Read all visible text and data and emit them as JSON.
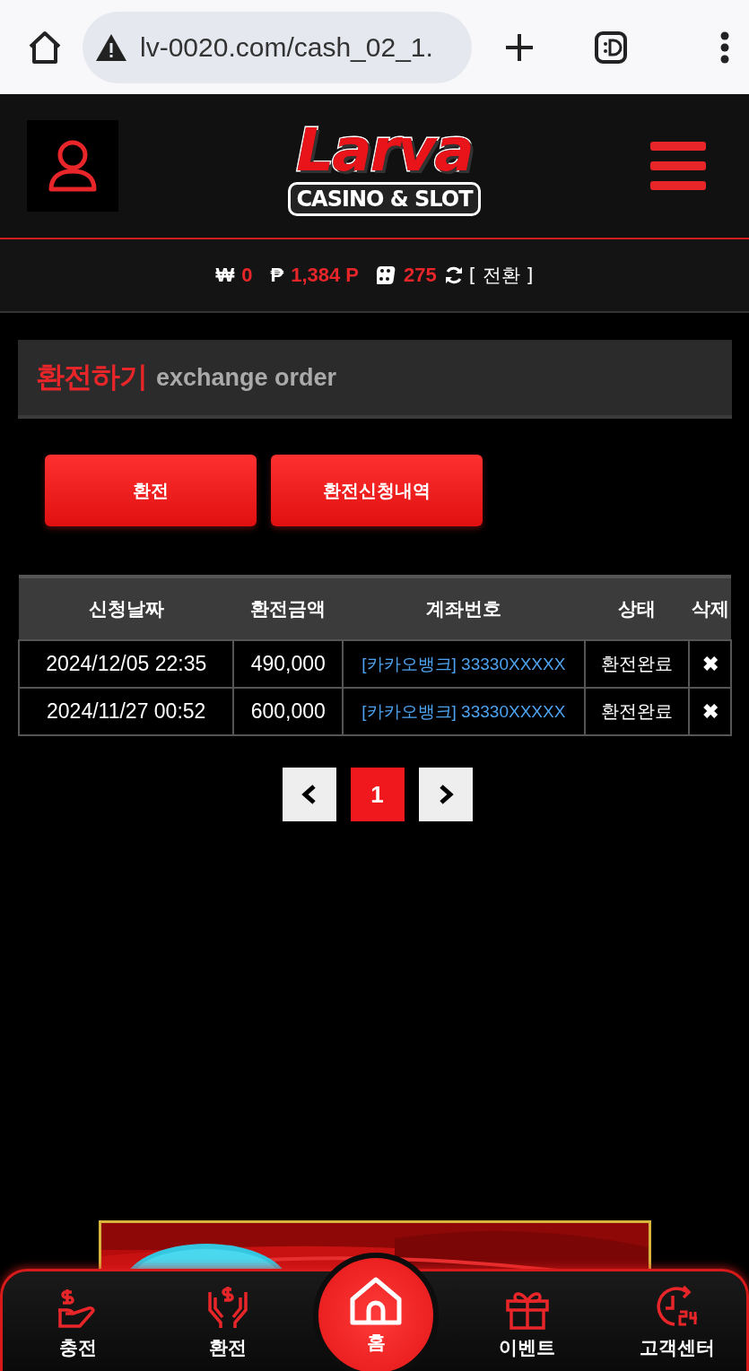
{
  "browser": {
    "url": "lv-0020.com/cash_02_1."
  },
  "header": {
    "logo": {
      "title": "Larva",
      "subtitle": "CASINO & SLOT"
    }
  },
  "balance": [
    {
      "kind": "won",
      "symbol": "₩",
      "value": "0"
    },
    {
      "kind": "point",
      "symbol": "₱",
      "value": "1,384 P"
    },
    {
      "kind": "dice",
      "value": "275"
    }
  ],
  "convert": "[ 전환 ]",
  "section": {
    "title": "환전하기",
    "subtitle": "exchange order"
  },
  "buttons": [
    "환전",
    "환전신청내역"
  ],
  "table": {
    "columns": [
      "신청날짜",
      "환전금액",
      "계좌번호",
      "상태",
      "삭제"
    ],
    "rows": [
      {
        "date": "2024/12/05 22:35",
        "amount": "490,000",
        "account": "[카카오뱅크] 33330XXXXX",
        "status": "환전완료",
        "delete": "✖"
      },
      {
        "date": "2024/11/27 00:52",
        "amount": "600,000",
        "account": "[카카오뱅크] 33330XXXXX",
        "status": "환전완료",
        "delete": "✖"
      }
    ]
  },
  "pagination": {
    "pages": [
      {
        "label": "1",
        "selected": true
      }
    ]
  },
  "banner": {
    "kind": "picture"
  },
  "nav": [
    {
      "kind": "deposit",
      "label": "충전"
    },
    {
      "kind": "withdraw",
      "label": "환전"
    },
    {
      "kind": "home",
      "label": "홈"
    },
    {
      "kind": "event",
      "label": "이벤트"
    },
    {
      "kind": "support",
      "label": "고객센터"
    }
  ]
}
